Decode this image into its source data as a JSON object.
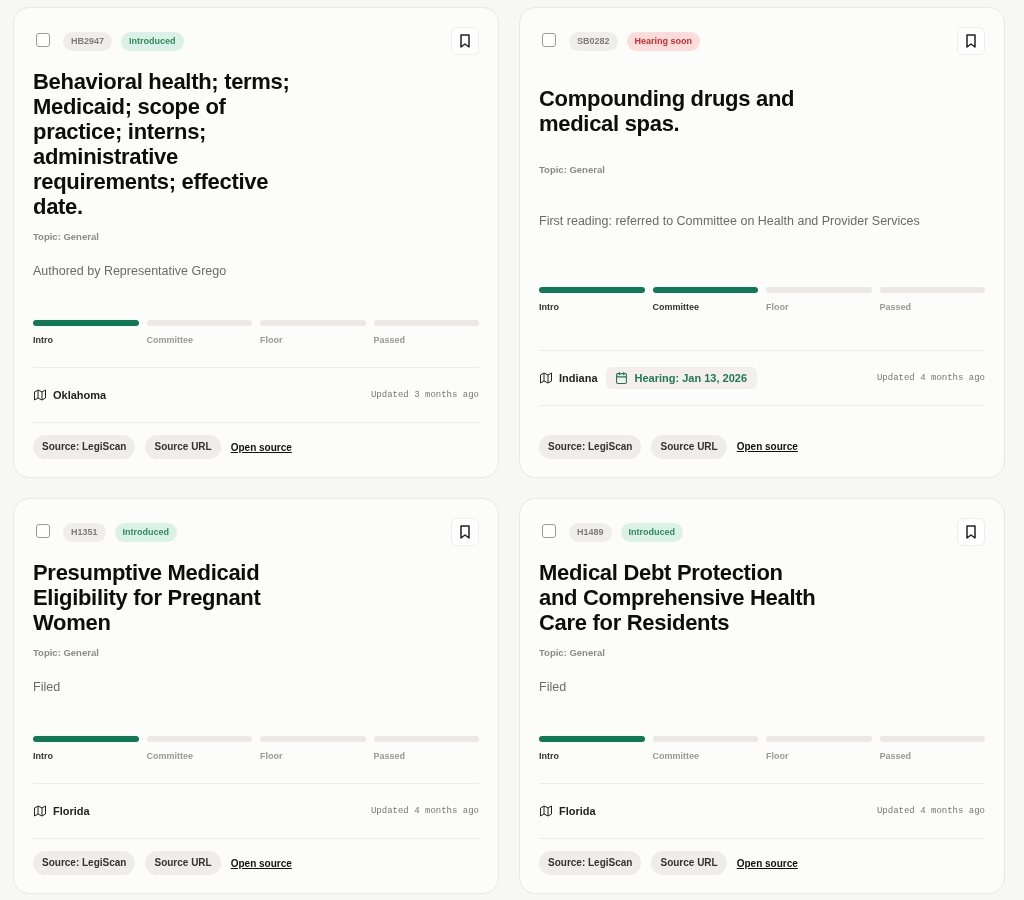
{
  "cards": [
    {
      "checked": false,
      "bill_number": "HB2947",
      "status": {
        "label": "Introduced",
        "kind": "introduced"
      },
      "bookmarked": false,
      "title": "Behavioral health; terms; Medicaid; scope of practice; interns; administrative requirements; effective date.",
      "topic": "Topic: General",
      "description": "Authored by Representative Grego",
      "stages": [
        {
          "label": "Intro",
          "reached": true
        },
        {
          "label": "Committee",
          "reached": false
        },
        {
          "label": "Floor",
          "reached": false
        },
        {
          "label": "Passed",
          "reached": false
        }
      ],
      "state": "Oklahoma",
      "updated": "Updated 3 months ago",
      "sources": [
        "Source: LegiScan",
        "Source URL"
      ],
      "link": "Open source"
    },
    {
      "checked": false,
      "bill_number": "SB0282",
      "status": {
        "label": "Hearing soon",
        "kind": "hearing"
      },
      "bookmarked": false,
      "title": "Compounding drugs and medical spas.",
      "topic": "Topic: General",
      "description": "First reading: referred to Committee on Health and Provider Services",
      "stages": [
        {
          "label": "Intro",
          "reached": true
        },
        {
          "label": "Committee",
          "reached": true
        },
        {
          "label": "Floor",
          "reached": false
        },
        {
          "label": "Passed",
          "reached": false
        }
      ],
      "state": "Indiana",
      "hearing": "Hearing: Jan 13, 2026",
      "updated": "Updated 4 months ago",
      "sources": [
        "Source: LegiScan",
        "Source URL"
      ],
      "link": "Open source"
    },
    {
      "checked": false,
      "bill_number": "H1351",
      "status": {
        "label": "Introduced",
        "kind": "introduced"
      },
      "bookmarked": false,
      "title": "Presumptive Medicaid Eligibility for Pregnant Women",
      "topic": "Topic: General",
      "description": "Filed",
      "stages": [
        {
          "label": "Intro",
          "reached": true
        },
        {
          "label": "Committee",
          "reached": false
        },
        {
          "label": "Floor",
          "reached": false
        },
        {
          "label": "Passed",
          "reached": false
        }
      ],
      "state": "Florida",
      "updated": "Updated 4 months ago",
      "sources": [
        "Source: LegiScan",
        "Source URL"
      ],
      "link": "Open source"
    },
    {
      "checked": false,
      "bill_number": "H1489",
      "status": {
        "label": "Introduced",
        "kind": "introduced"
      },
      "bookmarked": false,
      "title": "Medical Debt Protection and Comprehensive Health Care for Residents",
      "topic": "Topic: General",
      "description": "Filed",
      "stages": [
        {
          "label": "Intro",
          "reached": true
        },
        {
          "label": "Committee",
          "reached": false
        },
        {
          "label": "Floor",
          "reached": false
        },
        {
          "label": "Passed",
          "reached": false
        }
      ],
      "state": "Florida",
      "updated": "Updated 4 months ago",
      "sources": [
        "Source: LegiScan",
        "Source URL"
      ],
      "link": "Open source"
    }
  ]
}
